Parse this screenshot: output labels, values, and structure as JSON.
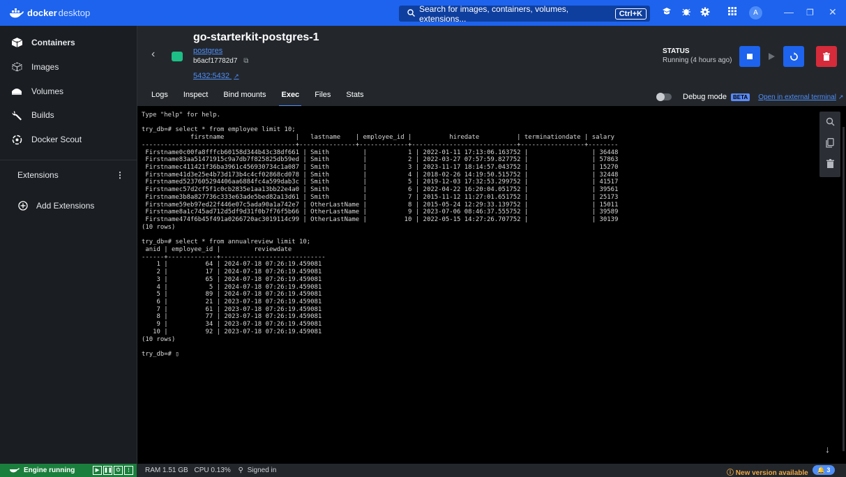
{
  "titlebar": {
    "logo_bold": "docker",
    "logo_light": "desktop",
    "search_placeholder": "Search for images, containers, volumes, extensions...",
    "search_shortcut": "Ctrl+K",
    "avatar_initial": "A"
  },
  "sidebar": {
    "items": [
      {
        "label": "Containers",
        "icon": "container-icon"
      },
      {
        "label": "Images",
        "icon": "images-icon"
      },
      {
        "label": "Volumes",
        "icon": "volumes-icon"
      },
      {
        "label": "Builds",
        "icon": "wrench-icon"
      },
      {
        "label": "Docker Scout",
        "icon": "scout-icon"
      }
    ],
    "extensions_label": "Extensions",
    "add_extensions_label": "Add Extensions"
  },
  "container": {
    "name": "go-starterkit-postgres-1",
    "image": "postgres",
    "id": "b6acf17782d7",
    "port": "5432:5432"
  },
  "status": {
    "label": "STATUS",
    "value": "Running (4 hours ago)"
  },
  "tabs": [
    "Logs",
    "Inspect",
    "Bind mounts",
    "Exec",
    "Files",
    "Stats"
  ],
  "active_tab": "Exec",
  "debug": {
    "label": "Debug mode",
    "beta": "BETA",
    "link": "Open in external terminal"
  },
  "terminal": {
    "output": "Type \"help\" for help.\n\ntry_db=# select * from employee limit 10;\n             firstname                   |   lastname    | employee_id |          hiredate          | terminationdate | salary\n-----------------------------------------+---------------+-------------+----------------------------+-----------------+--------\n Firstname0c00fa8fffcb60158d344b43c38df661 | Smith         |           1 | 2022-01-11 17:13:06.163752 |                 | 36448\n Firstname83aa51471915c9a7db7f825825db59ed | Smith         |           2 | 2022-03-27 07:57:59.827752 |                 | 57863\n Firstnamec411421f36ba3961c456930734c1a087 | Smith         |           3 | 2023-11-17 18:14:57.043752 |                 | 15270\n Firstname41d3e25e4b73d173b4c4cf02868cd078 | Smith         |           4 | 2018-02-26 14:19:50.515752 |                 | 32448\n Firstnamed5237605294406aa6884fc4a599dab3c | Smith         |           5 | 2019-12-03 17:32:53.299752 |                 | 41517\n Firstnamec57d2cf5f1c0cb2835e1aa13bb22e4a0 | Smith         |           6 | 2022-04-22 16:20:04.051752 |                 | 39561\n Firstname3b8a827736c333e63ade5bed82a13d61 | Smith         |           7 | 2015-11-12 11:27:01.651752 |                 | 25173\n Firstname59eb97ed22f446e07c5ada90a1a742e7 | OtherLastName |           8 | 2015-05-24 12:29:33.139752 |                 | 15011\n Firstname8a1c745ad712d5df9d31f0b7f76f5b66 | OtherLastName |           9 | 2023-07-06 08:46:37.555752 |                 | 39589\n Firstname474f6b45f491a0266720ac3019114c99 | OtherLastName |          10 | 2022-05-15 14:27:26.707752 |                 | 30139\n(10 rows)\n\ntry_db=# select * from annualreview limit 10;\n anid | employee_id |         reviewdate\n------+-------------+----------------------------\n    1 |          64 | 2024-07-18 07:26:19.459081\n    2 |          17 | 2024-07-18 07:26:19.459081\n    3 |          65 | 2024-07-18 07:26:19.459081\n    4 |           5 | 2024-07-18 07:26:19.459081\n    5 |          89 | 2024-07-18 07:26:19.459081\n    6 |          21 | 2023-07-18 07:26:19.459081\n    7 |          61 | 2023-07-18 07:26:19.459081\n    8 |          77 | 2023-07-18 07:26:19.459081\n    9 |          34 | 2023-07-18 07:26:19.459081\n   10 |          92 | 2023-07-18 07:26:19.459081\n(10 rows)\n\ntry_db=# ▯"
  },
  "footer": {
    "engine": "Engine running",
    "ram": "RAM 1.51 GB",
    "cpu": "CPU 0.13%",
    "signed_in": "Signed in",
    "new_version": "New version available",
    "notifications": "3"
  },
  "colors": {
    "brand": "#1d63ed",
    "stop": "#1d63ed",
    "delete": "#d62b3a",
    "engine": "#1a7f3c"
  }
}
